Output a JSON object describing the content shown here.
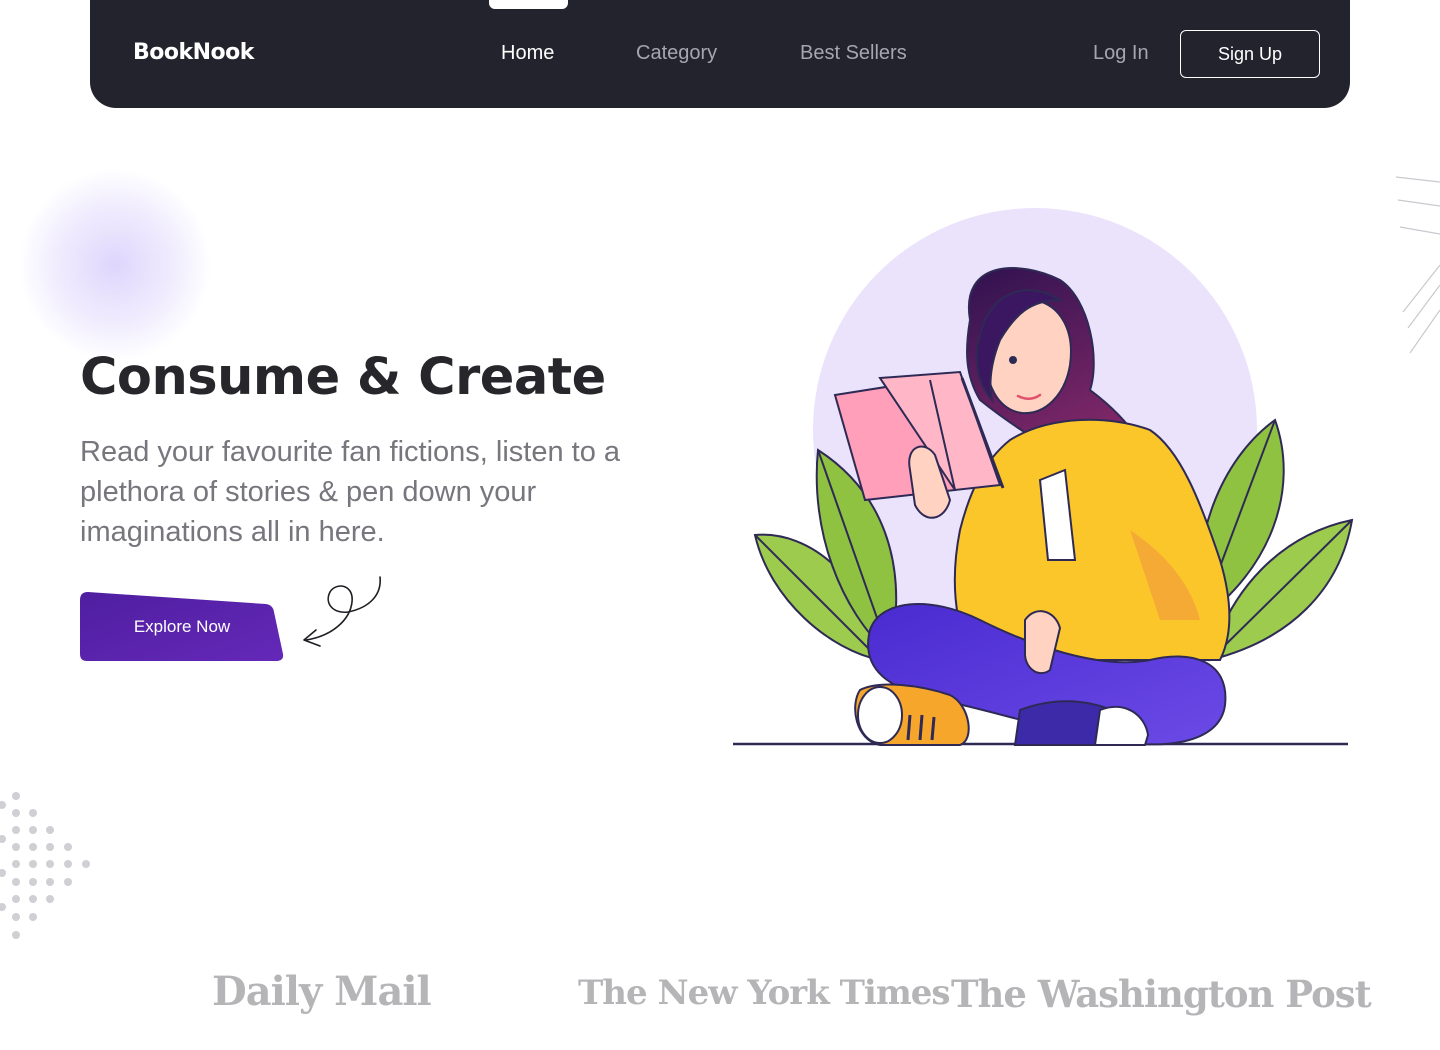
{
  "navbar": {
    "logo": "BookNook",
    "links": [
      {
        "label": "Home",
        "active": true
      },
      {
        "label": "Category",
        "active": false
      },
      {
        "label": "Best Sellers",
        "active": false
      }
    ],
    "login_label": "Log In",
    "signup_label": "Sign Up"
  },
  "hero": {
    "title": "Consume & Create",
    "description": "Read your favourite fan fictions, listen to a plethora of stories & pen down your imaginations all in here.",
    "cta_label": "Explore Now"
  },
  "press_logos": [
    "Daily Mail",
    "The New York Times",
    "The Washington Post"
  ],
  "colors": {
    "navbar_bg": "#23232d",
    "accent": "#5b22a8",
    "illustration_circle": "#ebe3fb"
  }
}
